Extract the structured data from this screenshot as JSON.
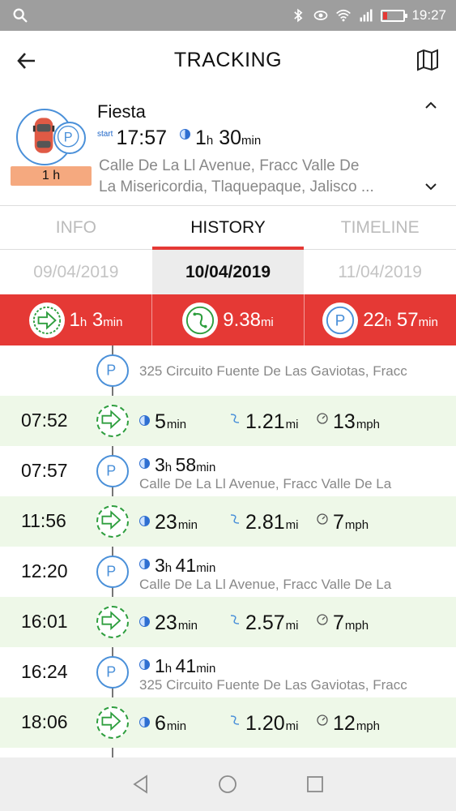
{
  "status_bar": {
    "time": "19:27",
    "battery_color": "#e53935"
  },
  "header": {
    "title": "TRACKING",
    "back_icon": "arrow-left-icon",
    "map_icon": "map-icon"
  },
  "vehicle": {
    "name": "Fiesta",
    "start_label": "start",
    "start_time": "17:57",
    "duration_h": "1",
    "duration_h_unit": "h",
    "duration_min": "30",
    "duration_min_unit": "min",
    "badge": "1 h",
    "address_line1": "Calle De La Ll Avenue, Fracc Valle De",
    "address_line2": "La Misericordia, Tlaquepaque, Jalisco ..."
  },
  "tabs": [
    {
      "label": "INFO",
      "active": false
    },
    {
      "label": "HISTORY",
      "active": true
    },
    {
      "label": "TIMELINE",
      "active": false
    }
  ],
  "dates": [
    {
      "label": "09/04/2019",
      "active": false
    },
    {
      "label": "10/04/2019",
      "active": true
    },
    {
      "label": "11/04/2019",
      "active": false
    }
  ],
  "summary": {
    "drive_time": {
      "h": "1",
      "h_unit": "h",
      "min": "3",
      "min_unit": "min"
    },
    "distance": {
      "value": "9.38",
      "unit": "mi"
    },
    "parked_time": {
      "h": "22",
      "h_unit": "h",
      "min": "57",
      "min_unit": "min"
    }
  },
  "first_address": "325 Circuito Fuente De Las Gaviotas, Fracc",
  "events": [
    {
      "type": "drive",
      "time": "07:52",
      "duration": "5",
      "duration_unit": "min",
      "distance": "1.21",
      "distance_unit": "mi",
      "speed": "13",
      "speed_unit": "mph"
    },
    {
      "type": "park",
      "time": "07:57",
      "h": "3",
      "h_unit": "h",
      "min": "58",
      "min_unit": "min",
      "address": "Calle De La Ll Avenue, Fracc Valle De La"
    },
    {
      "type": "drive",
      "time": "11:56",
      "duration": "23",
      "duration_unit": "min",
      "distance": "2.81",
      "distance_unit": "mi",
      "speed": "7",
      "speed_unit": "mph"
    },
    {
      "type": "park",
      "time": "12:20",
      "h": "3",
      "h_unit": "h",
      "min": "41",
      "min_unit": "min",
      "address": "Calle De La Ll Avenue, Fracc Valle De La"
    },
    {
      "type": "drive",
      "time": "16:01",
      "duration": "23",
      "duration_unit": "min",
      "distance": "2.57",
      "distance_unit": "mi",
      "speed": "7",
      "speed_unit": "mph"
    },
    {
      "type": "park",
      "time": "16:24",
      "h": "1",
      "h_unit": "h",
      "min": "41",
      "min_unit": "min",
      "address": "325 Circuito Fuente De Las Gaviotas, Fracc"
    },
    {
      "type": "drive",
      "time": "18:06",
      "duration": "6",
      "duration_unit": "min",
      "distance": "1.20",
      "distance_unit": "mi",
      "speed": "12",
      "speed_unit": "mph"
    }
  ],
  "colors": {
    "accent_red": "#e53935",
    "park_blue": "#4a90d9",
    "drive_green": "#2e9e3e",
    "drive_row_bg": "#eef8e8"
  }
}
